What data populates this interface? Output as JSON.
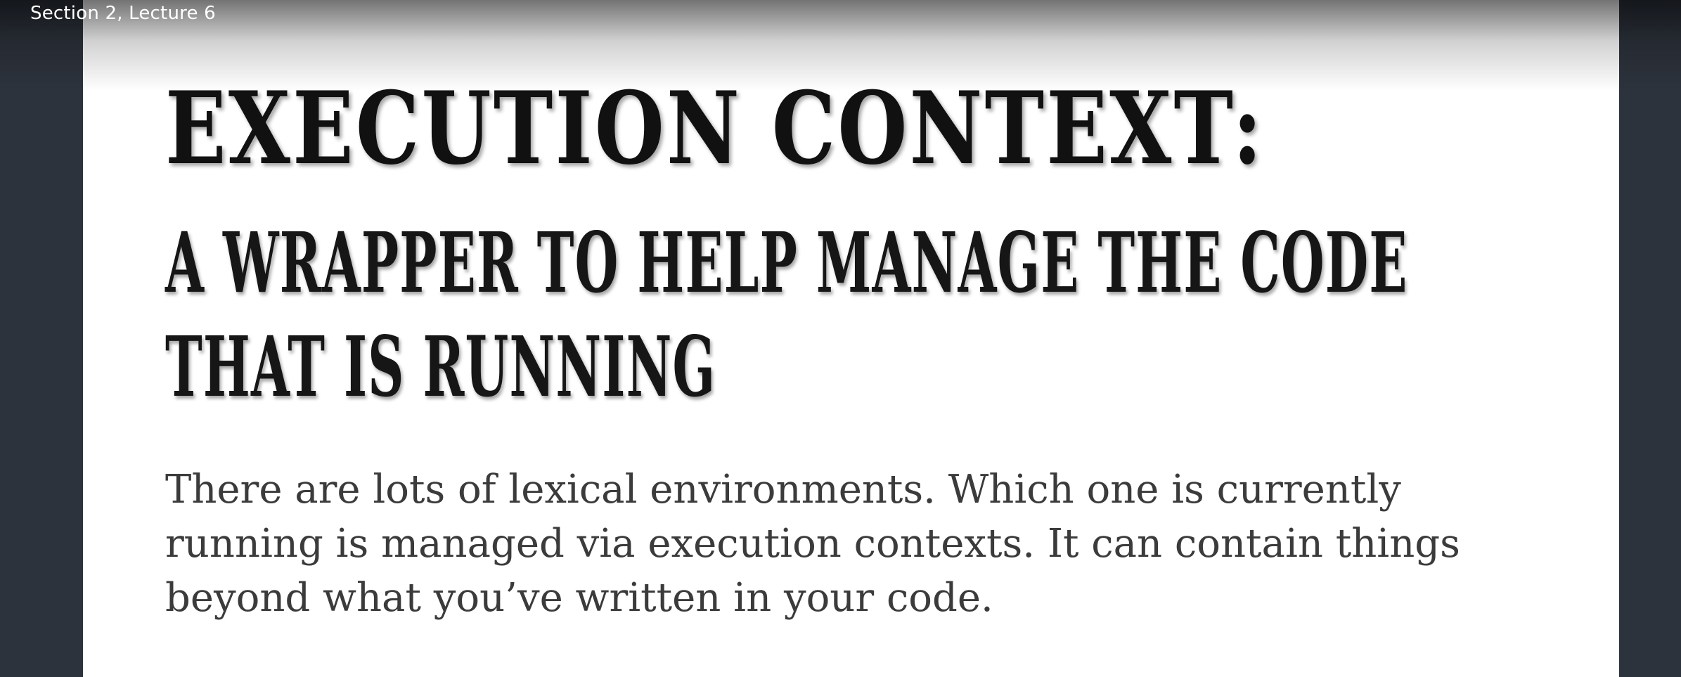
{
  "player": {
    "lecture_label": "Section 2, Lecture 6"
  },
  "slide": {
    "title": "EXECUTION CONTEXT:",
    "subtitle_lines": [
      "A WRAPPER TO HELP MANAGE THE CODE",
      "THAT IS RUNNING"
    ],
    "body": "There are lots of lexical environments. Which one is currently running is managed via execution contexts. It can contain things beyond what you’ve written in your code."
  },
  "colors": {
    "side_panels": "#2d333c",
    "slide_background": "#ffffff",
    "title_text": "#111111",
    "body_text": "#3b3b3b"
  }
}
